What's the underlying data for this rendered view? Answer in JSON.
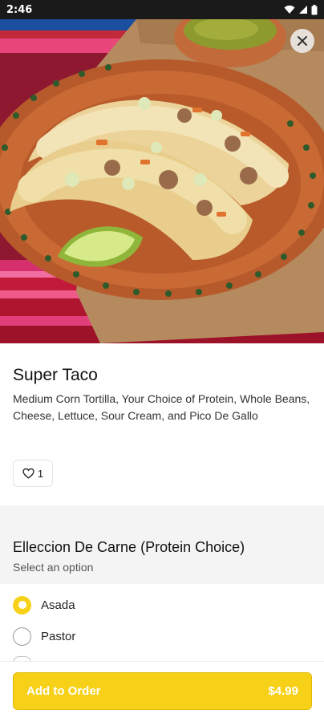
{
  "status_bar": {
    "time": "2:46"
  },
  "item": {
    "title": "Super Taco",
    "description": "Medium Corn Tortilla, Your Choice of Protein, Whole Beans, Cheese, Lettuce, Sour Cream, and Pico De Gallo",
    "like_count": "1"
  },
  "protein_section": {
    "title": "Elleccion De Carne (Protein Choice)",
    "subtitle": "Select an option",
    "options": [
      {
        "label": "Asada",
        "selected": true
      },
      {
        "label": "Pastor",
        "selected": false
      }
    ]
  },
  "footer": {
    "add_label": "Add to Order",
    "price": "$4.99"
  },
  "colors": {
    "accent": "#f7d117",
    "text": "#111111",
    "section_bg": "#f4f4f4"
  }
}
